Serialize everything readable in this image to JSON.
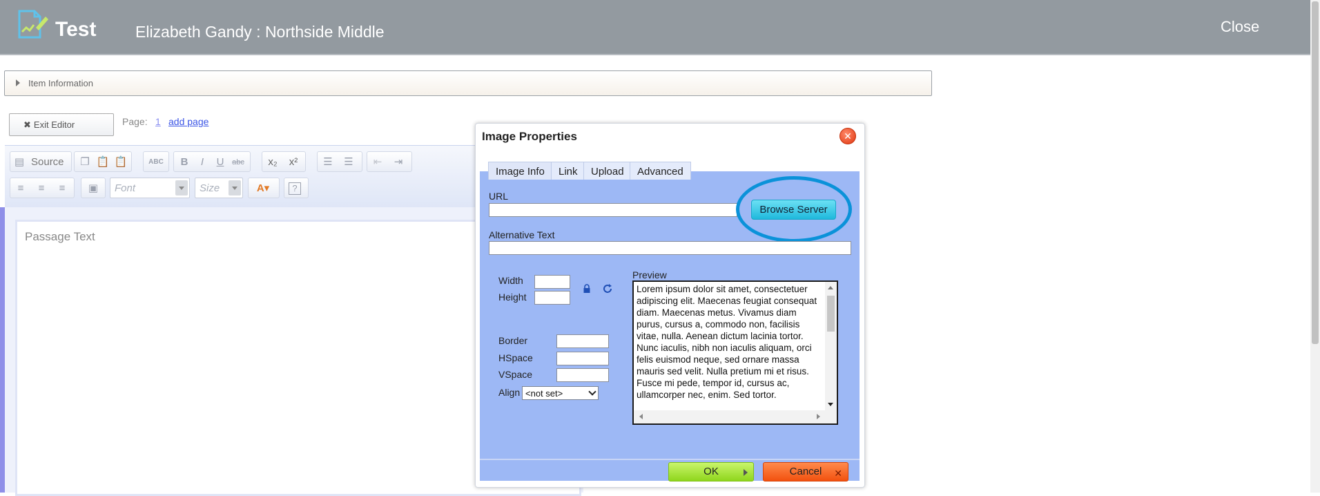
{
  "header": {
    "app_title": "Test",
    "student": "Elizabeth Gandy : Northside Middle",
    "close_label": "Close"
  },
  "item_info": {
    "label": "Item Information"
  },
  "editor_nav": {
    "exit_label": "Exit Editor",
    "page_label": "Page:",
    "page_number": "1",
    "add_page_label": "add page"
  },
  "toolbar": {
    "source_label": "Source",
    "font_placeholder": "Font",
    "size_placeholder": "Size"
  },
  "editor": {
    "placeholder": "Passage Text"
  },
  "dialog": {
    "title": "Image Properties",
    "tabs": [
      {
        "label": "Image Info"
      },
      {
        "label": "Link"
      },
      {
        "label": "Upload"
      },
      {
        "label": "Advanced"
      }
    ],
    "url_label": "URL",
    "url_value": "",
    "browse_label": "Browse Server",
    "alt_label": "Alternative Text",
    "alt_value": "",
    "width_label": "Width",
    "height_label": "Height",
    "border_label": "Border",
    "hspace_label": "HSpace",
    "vspace_label": "VSpace",
    "align_label": "Align",
    "align_value": "<not set>",
    "preview_label": "Preview",
    "preview_text": "Lorem ipsum dolor sit amet, consectetuer adipiscing elit. Maecenas feugiat consequat diam. Maecenas metus. Vivamus diam purus, cursus a, commodo non, facilisis vitae, nulla. Aenean dictum lacinia tortor. Nunc iaculis, nibh non iaculis aliquam, orci felis euismod neque, sed ornare massa mauris sed velit. Nulla pretium mi et risus. Fusce mi pede, tempor id, cursus ac, ullamcorper nec, enim. Sed tortor.",
    "ok_label": "OK",
    "cancel_label": "Cancel"
  },
  "colors": {
    "header_bg": "#939aa0",
    "dialog_body": "#9db8f5",
    "highlight_circle": "#0a92d9",
    "ok_green": "#8fd61d",
    "cancel_orange": "#f2510f"
  }
}
